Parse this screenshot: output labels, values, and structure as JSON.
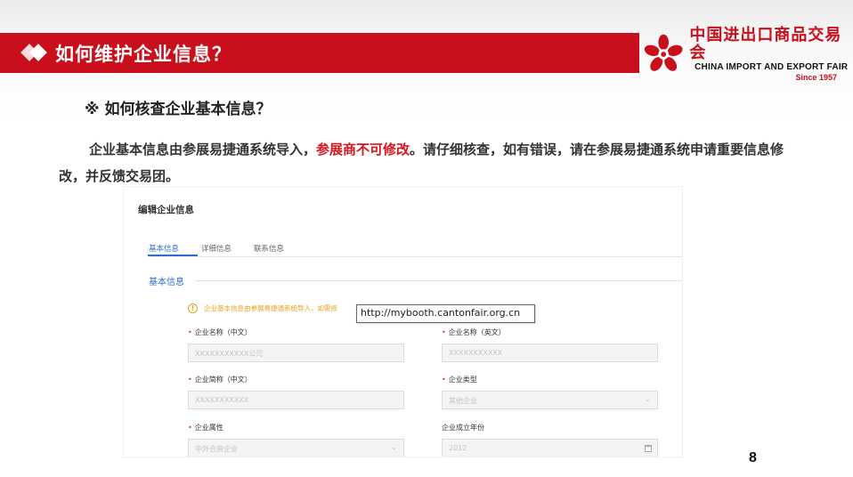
{
  "header": {
    "title": "如何维护企业信息？"
  },
  "logo": {
    "cn": "中国进出口商品交易会",
    "en": "CHINA IMPORT AND EXPORT FAIR",
    "since": "Since 1957",
    "color": "#c80f1b"
  },
  "content": {
    "subheading": "※ 如何核查企业基本信息？",
    "para_part1": "企业基本信息由参展易捷通系统导入，",
    "para_highlight": "参展商不可修改",
    "para_part2": "。请仔细核查，如有错误，请在参展易捷通系统申请重要信息修改，并反馈交易团。"
  },
  "screenshot": {
    "title": "编辑企业信息",
    "tabs": [
      {
        "label": "基本信息",
        "active": true
      },
      {
        "label": "详细信息",
        "active": false
      },
      {
        "label": "联系信息",
        "active": false
      }
    ],
    "section_label": "基本信息",
    "notice": "企业基本信息由参展易捷通系统导入，如需修",
    "notice_icon": "!",
    "tooltip": "http://mybooth.cantonfair.org.cn",
    "fields": [
      {
        "label": "企业名称（中文）",
        "required": true,
        "value": "XXXXXXXXXXX公司",
        "type": "text"
      },
      {
        "label": "企业名称（英文）",
        "required": true,
        "value": "XXXXXXXXXXX",
        "type": "text"
      },
      {
        "label": "企业简称（中文）",
        "required": true,
        "value": "XXXXXXXXXXX",
        "type": "text"
      },
      {
        "label": "企业类型",
        "required": true,
        "value": "其他企业",
        "type": "select"
      },
      {
        "label": "企业属性",
        "required": true,
        "value": "中外合资企业",
        "type": "select"
      },
      {
        "label": "企业成立年份",
        "required": false,
        "value": "2012",
        "type": "date"
      }
    ],
    "required_mark": "•",
    "chevron": "⌄"
  },
  "page": {
    "number": "8"
  },
  "colors": {
    "brand_red": "#c80f1b",
    "highlight_red": "#d9141e",
    "tab_blue": "#2a6fc9",
    "notice_orange": "#e8a21a"
  }
}
